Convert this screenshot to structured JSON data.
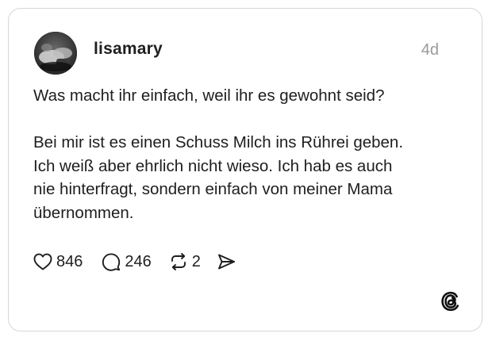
{
  "post": {
    "username": "lisamary",
    "timestamp": "4d",
    "text": "Was macht ihr einfach, weil ihr es gewohnt seid?\n\nBei mir ist es einen Schuss Milch ins Rührei geben.\nIch weiß aber ehrlich nicht wieso. Ich hab es auch\nnie hinterfragt, sondern einfach von meiner Mama\nübernommen.",
    "avatar_icon": "user-avatar-photo"
  },
  "actions": {
    "likes": "846",
    "replies": "246",
    "reposts": "2",
    "like_icon": "heart-icon",
    "reply_icon": "speech-bubble-icon",
    "repost_icon": "repost-arrows-icon",
    "share_icon": "send-icon"
  },
  "branding": {
    "logo_icon": "threads-logo-icon"
  },
  "colors": {
    "text": "#1e1e1e",
    "muted": "#9a9a9a",
    "border": "#d6d6d6",
    "background": "#ffffff"
  }
}
